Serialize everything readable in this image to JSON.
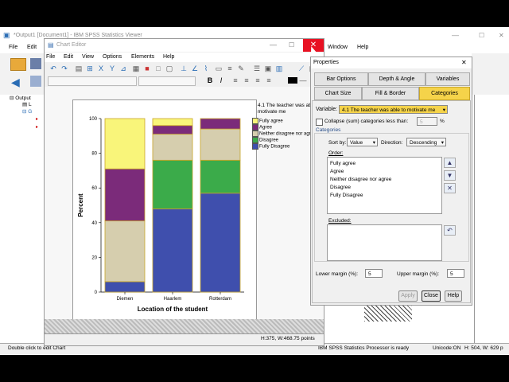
{
  "viewer": {
    "title": "*Output1 [Document1] - IBM SPSS Statistics Viewer",
    "menu": [
      "File",
      "Edit",
      "Window",
      "Help"
    ],
    "status_left": "Double click to edit Chart",
    "status_mid": "IBM SPSS Statistics Processor is ready",
    "status_unicode": "Unicode:ON",
    "status_size": "H: 504, W: 629 p"
  },
  "chart_editor": {
    "title": "Chart Editor",
    "menu": [
      "File",
      "Edit",
      "View",
      "Options",
      "Elements",
      "Help"
    ],
    "status": "H:375, W:468.75 points",
    "legend_title": "4.1 The teacher was able to motivate me",
    "close_glyph": "✕"
  },
  "chart_data": {
    "type": "bar",
    "stacked": true,
    "categories": [
      "Diemen",
      "Haarlem",
      "Rotterdam"
    ],
    "xlabel": "Location of the student",
    "ylabel": "Percent",
    "ylim": [
      0,
      100
    ],
    "yticks": [
      0,
      20,
      40,
      60,
      80,
      100
    ],
    "series": [
      {
        "name": "Fully Disagree",
        "color": "#3f4fad",
        "values": [
          6,
          48,
          57
        ]
      },
      {
        "name": "Disagree",
        "color": "#3bab4a",
        "values": [
          0,
          28,
          19
        ]
      },
      {
        "name": "Neither disagree nor agree",
        "color": "#d6ceae",
        "values": [
          35,
          15,
          18
        ]
      },
      {
        "name": "Agree",
        "color": "#7b2b7a",
        "values": [
          30,
          5,
          6
        ]
      },
      {
        "name": "Fully agree",
        "color": "#f9f57a",
        "values": [
          29,
          4,
          0
        ]
      }
    ],
    "legend": [
      "Fully agree",
      "Agree",
      "Neither disagree nor agree",
      "Disagree",
      "Fully Disagree"
    ],
    "legend_display": [
      "Fully agree",
      "Agree",
      "Neither disagree nor agr",
      "Disagree",
      "Fully Disagree"
    ],
    "legend_position": "right",
    "grid": false
  },
  "properties": {
    "title": "Properties",
    "tabs_row1": [
      "Bar Options",
      "Depth & Angle",
      "Variables"
    ],
    "tabs_row2": [
      "Chart Size",
      "Fill & Border",
      "Categories"
    ],
    "active_tab": "Categories",
    "variable_label": "Variable:",
    "variable_value": "4.1 The teacher was able to motivate me",
    "collapse_label": "Collapse (sum) categories less than:",
    "collapse_value": "5",
    "collapse_unit": "%",
    "categories_group": "Categories",
    "sortby_label": "Sort by:",
    "sortby_value": "Value",
    "direction_label": "Direction:",
    "direction_value": "Descending",
    "order_label": "Order:",
    "order_items": [
      "Fully agree",
      "Agree",
      "Neither disagree nor agree",
      "Disagree",
      "Fully Disagree"
    ],
    "excluded_label": "Excluded:",
    "lower_margin_label": "Lower margin (%):",
    "lower_margin_value": "5",
    "upper_margin_label": "Upper margin (%):",
    "upper_margin_value": "5",
    "buttons": {
      "apply": "Apply",
      "close": "Close",
      "help": "Help"
    }
  }
}
